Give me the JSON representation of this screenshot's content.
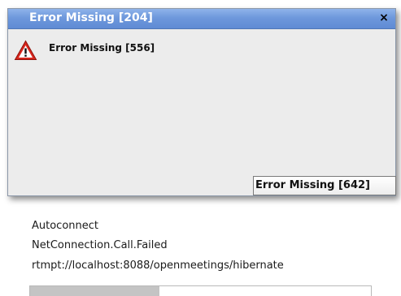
{
  "dialog": {
    "title": "Error Missing [204]",
    "close_glyph": "×",
    "icon": "warning-triangle-icon",
    "message": "Error Missing [556]",
    "button_label": "Error Missing [642]",
    "colors": {
      "titlebar": "#6e98dc",
      "body": "#ececec",
      "icon_red": "#d8261c"
    }
  },
  "status": {
    "line1": "Autoconnect",
    "line2": "NetConnection.Call.Failed",
    "line3": "rtmpt://localhost:8088/openmeetings/hibernate",
    "progress": 0.38
  }
}
